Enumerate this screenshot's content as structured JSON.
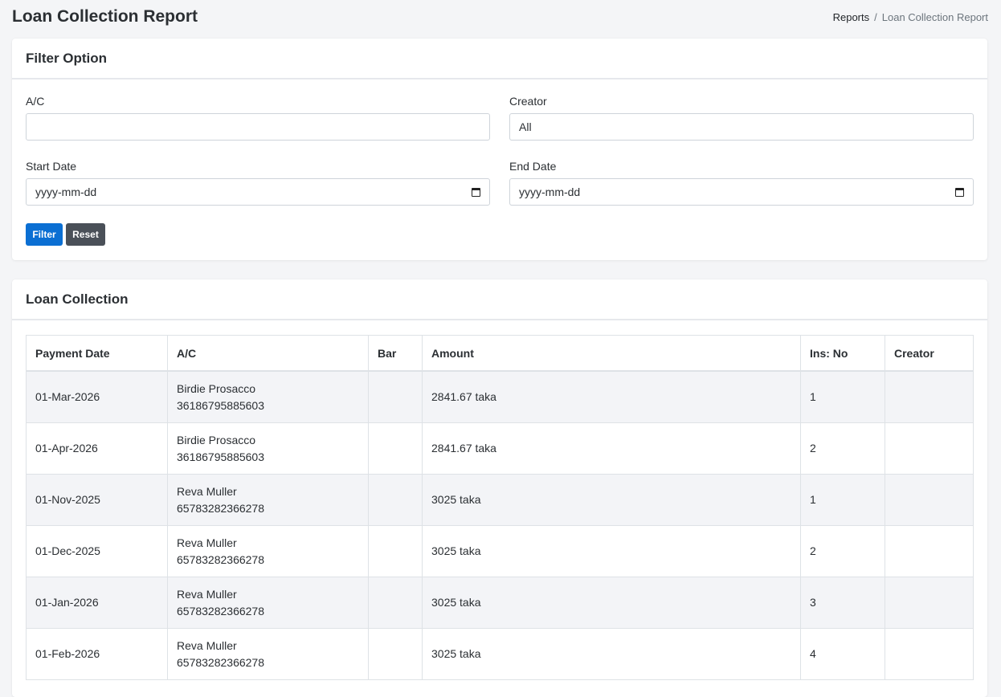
{
  "page": {
    "title": "Loan Collection Report",
    "breadcrumb": {
      "parent": "Reports",
      "separator": "/",
      "current": "Loan Collection Report"
    }
  },
  "filter": {
    "title": "Filter Option",
    "ac_label": "A/C",
    "ac_value": "",
    "creator_label": "Creator",
    "creator_value": "All",
    "start_label": "Start Date",
    "start_value": "yyyy-mm-dd",
    "end_label": "End Date",
    "end_value": "yyyy-mm-dd",
    "filter_button": "Filter",
    "reset_button": "Reset"
  },
  "collection": {
    "title": "Loan Collection",
    "columns": [
      "Payment Date",
      "A/C",
      "Bar",
      "Amount",
      "Ins: No",
      "Creator"
    ],
    "rows": [
      {
        "date": "01-Mar-2026",
        "name": "Birdie Prosacco",
        "account": "36186795885603",
        "bar": "",
        "amount": "2841.67 taka",
        "ins": "1",
        "creator": ""
      },
      {
        "date": "01-Apr-2026",
        "name": "Birdie Prosacco",
        "account": "36186795885603",
        "bar": "",
        "amount": "2841.67 taka",
        "ins": "2",
        "creator": ""
      },
      {
        "date": "01-Nov-2025",
        "name": "Reva Muller",
        "account": "65783282366278",
        "bar": "",
        "amount": "3025 taka",
        "ins": "1",
        "creator": ""
      },
      {
        "date": "01-Dec-2025",
        "name": "Reva Muller",
        "account": "65783282366278",
        "bar": "",
        "amount": "3025 taka",
        "ins": "2",
        "creator": ""
      },
      {
        "date": "01-Jan-2026",
        "name": "Reva Muller",
        "account": "65783282366278",
        "bar": "",
        "amount": "3025 taka",
        "ins": "3",
        "creator": ""
      },
      {
        "date": "01-Feb-2026",
        "name": "Reva Muller",
        "account": "65783282366278",
        "bar": "",
        "amount": "3025 taka",
        "ins": "4",
        "creator": ""
      }
    ]
  }
}
